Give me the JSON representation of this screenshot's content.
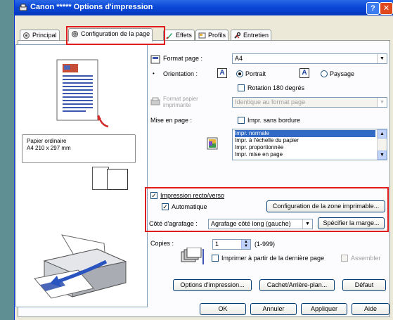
{
  "window": {
    "title": "Canon *****   Options d'impression",
    "help_label": "?",
    "close_label": "✕"
  },
  "tabs": [
    {
      "label": "Principal"
    },
    {
      "label": "Configuration de la page"
    },
    {
      "label": "Effets"
    },
    {
      "label": "Profils"
    },
    {
      "label": "Entretien"
    }
  ],
  "preview": {
    "paper_type": "Papier ordinaire",
    "paper_size": "A4 210 x 297 mm"
  },
  "format": {
    "label": "Format page :",
    "value": "A4"
  },
  "orientation": {
    "label": "Orientation :",
    "portrait_label": "Portrait",
    "landscape_label": "Paysage",
    "rotate_label": "Rotation 180 degrés",
    "icon_letter": "A"
  },
  "printer_paper": {
    "label_line1": "Format papier",
    "label_line2": "imprimante",
    "value": "Identique au format page"
  },
  "layout": {
    "label": "Mise en page :",
    "borderless_label": "Impr. sans bordure",
    "options": [
      "Impr. normale",
      "Impr. à l'échelle du papier",
      "Impr. proportionnée",
      "Impr. mise en page"
    ]
  },
  "duplex": {
    "label": "Impression recto/verso",
    "auto_label": "Automatique",
    "print_area_button": "Configuration de la zone imprimable...",
    "stapling_label": "Côté d'agrafage :",
    "stapling_value": "Agrafage côté long (gauche)",
    "margin_button": "Spécifier la marge..."
  },
  "copies": {
    "label": "Copies :",
    "value": "1",
    "range": "(1-999)",
    "last_page_label": "Imprimer à partir de la dernière page",
    "collate_label": "Assembler"
  },
  "buttons": {
    "print_options": "Options d'impression...",
    "stamp": "Cachet/Arrière-plan...",
    "default": "Défaut",
    "ok": "OK",
    "cancel": "Annuler",
    "apply": "Appliquer",
    "help": "Aide"
  }
}
